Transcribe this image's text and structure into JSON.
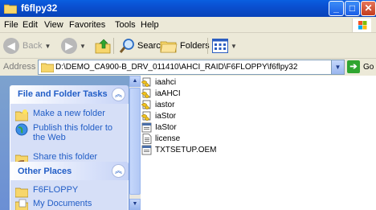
{
  "window": {
    "title": "f6flpy32",
    "controls": {
      "minimize": "_",
      "maximize": "□",
      "close": "✕"
    }
  },
  "menu": [
    "File",
    "Edit",
    "View",
    "Favorites",
    "Tools",
    "Help"
  ],
  "toolbar": {
    "back_label": "Back",
    "search_label": "Search",
    "folders_label": "Folders"
  },
  "address": {
    "label": "Address",
    "path": "D:\\DEMO_CA900-B_DRV_011410\\AHCI_RAID\\F6FLOPPY\\f6flpy32",
    "go_label": "Go"
  },
  "file_tasks": {
    "title": "File and Folder Tasks",
    "items": [
      {
        "label": "Make a new folder",
        "icon": "new-folder-icon"
      },
      {
        "label": "Publish this folder to the Web",
        "icon": "publish-web-icon"
      },
      {
        "label": "Share this folder",
        "icon": "share-folder-icon"
      }
    ]
  },
  "other_places": {
    "title": "Other Places",
    "items": [
      {
        "label": "F6FLOPPY",
        "icon": "folder-icon"
      },
      {
        "label": "My Documents",
        "icon": "my-documents-icon"
      }
    ]
  },
  "files": [
    {
      "name": "iaahci",
      "icon": "setup-info-icon"
    },
    {
      "name": "iaAHCI",
      "icon": "setup-info-icon"
    },
    {
      "name": "iastor",
      "icon": "setup-info-icon"
    },
    {
      "name": "iaStor",
      "icon": "setup-info-icon"
    },
    {
      "name": "IaStor",
      "icon": "system-file-icon"
    },
    {
      "name": "license",
      "icon": "text-file-icon"
    },
    {
      "name": "TXTSETUP.OEM",
      "icon": "system-file-icon"
    }
  ],
  "colors": {
    "titlebar": "#0a4fd0",
    "task_pane": "#6b8fd4",
    "task_link": "#215dc6"
  }
}
